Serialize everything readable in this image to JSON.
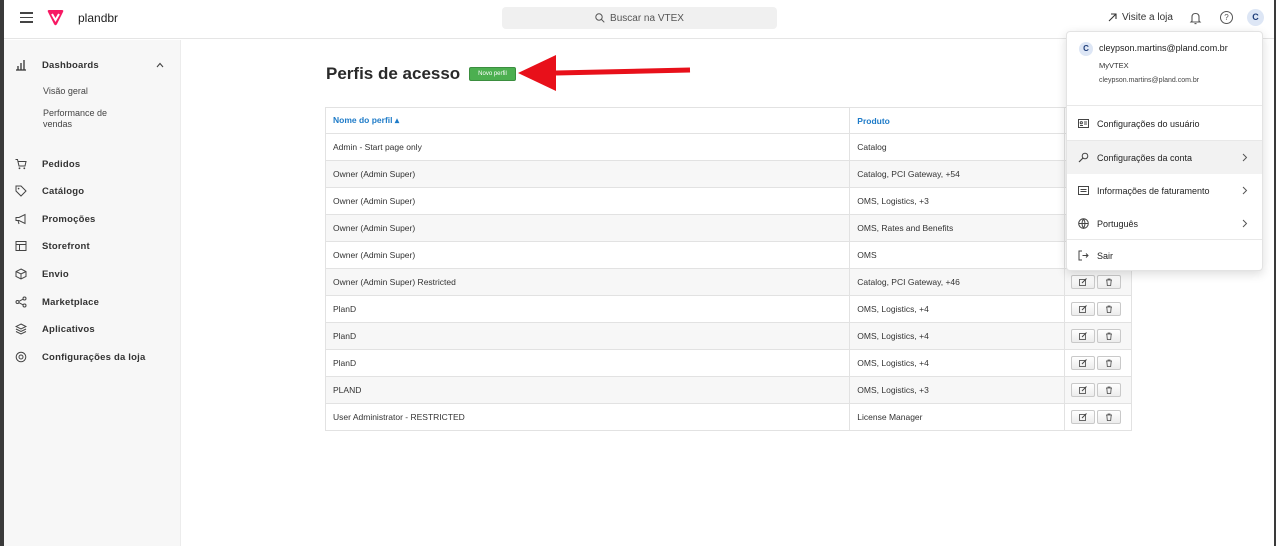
{
  "topbar": {
    "account_name": "plandbr",
    "search_placeholder": "Buscar na VTEX",
    "visit_store": "Visite a loja",
    "avatar_initial": "C"
  },
  "sidebar": {
    "dashboards": "Dashboards",
    "sub_items": [
      "Visão geral",
      "Performance de vendas"
    ],
    "items": [
      {
        "label": "Pedidos",
        "icon": "cart-icon"
      },
      {
        "label": "Catálogo",
        "icon": "tag-icon"
      },
      {
        "label": "Promoções",
        "icon": "megaphone-icon"
      },
      {
        "label": "Storefront",
        "icon": "layout-icon"
      },
      {
        "label": "Envio",
        "icon": "box-icon"
      },
      {
        "label": "Marketplace",
        "icon": "share-icon"
      },
      {
        "label": "Aplicativos",
        "icon": "layers-icon"
      },
      {
        "label": "Configurações da loja",
        "icon": "gear-icon"
      }
    ]
  },
  "main": {
    "title": "Perfis de acesso",
    "new_profile_button": "Novo perfil",
    "table": {
      "headers": [
        "Nome do perfil ▴",
        "Produto"
      ],
      "rows": [
        {
          "name": "Admin - Start page only",
          "product": "Catalog"
        },
        {
          "name": "Owner (Admin Super)",
          "product": "Catalog, PCI Gateway, +54"
        },
        {
          "name": "Owner (Admin Super)",
          "product": "OMS, Logistics, +3"
        },
        {
          "name": "Owner (Admin Super)",
          "product": "OMS, Rates and Benefits"
        },
        {
          "name": "Owner (Admin Super)",
          "product": "OMS"
        },
        {
          "name": "Owner (Admin Super) Restricted",
          "product": "Catalog, PCI Gateway, +46"
        },
        {
          "name": "PlanD",
          "product": "OMS, Logistics, +4"
        },
        {
          "name": "PlanD",
          "product": "OMS, Logistics, +4"
        },
        {
          "name": "PlanD",
          "product": "OMS, Logistics, +4"
        },
        {
          "name": "PLAND",
          "product": "OMS, Logistics, +3"
        },
        {
          "name": "User Administrator - RESTRICTED",
          "product": "License Manager"
        }
      ]
    }
  },
  "user_menu": {
    "initial": "C",
    "email": "cleypson.martins@pland.com.br",
    "account": "MyVTEX",
    "email_secondary": "cleypson.martins@pland.com.br",
    "items": [
      {
        "label": "Configurações do usuário",
        "icon": "id-card-icon"
      },
      {
        "label": "Configurações da conta",
        "icon": "wrench-icon"
      },
      {
        "label": "Informações de faturamento",
        "icon": "invoice-icon"
      },
      {
        "label": "Português",
        "icon": "globe-icon"
      },
      {
        "label": "Sair",
        "icon": "logout-icon"
      }
    ]
  },
  "colors": {
    "brand": "#f71963",
    "link_blue": "#1e7bc8",
    "new_button_green": "#4caf50",
    "arrow_red": "#e8101a"
  }
}
